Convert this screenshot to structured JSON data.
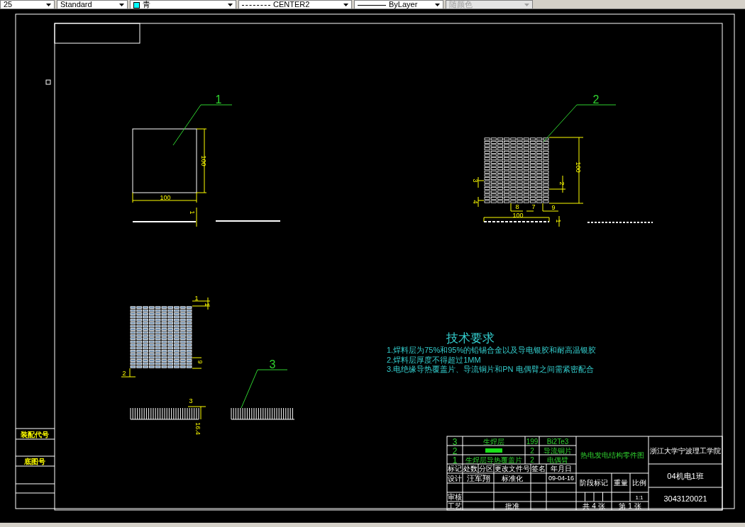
{
  "toolbar": [
    {
      "kind": "combo",
      "value": "25"
    },
    {
      "kind": "style-combo",
      "value": "Standard"
    },
    {
      "kind": "color-combo",
      "value": "青"
    },
    {
      "kind": "linetype-combo",
      "value": "CENTER2"
    },
    {
      "kind": "lineweight-combo",
      "value": "ByLayer"
    },
    {
      "kind": "combo",
      "value": "随颜色",
      "disabled": true
    }
  ],
  "left_panel": {
    "labels": [
      "装配代号",
      "底图号"
    ]
  },
  "balloons": [
    "1",
    "2",
    "3"
  ],
  "part1": {
    "dims": [
      "100",
      "100",
      "1"
    ]
  },
  "part2": {
    "dims": [
      "100",
      "3",
      "4",
      "2",
      "8",
      "7",
      "9",
      "100",
      "1"
    ]
  },
  "part3": {
    "dims": [
      "1",
      "1",
      "2",
      "9",
      "3",
      "16.4"
    ]
  },
  "tech_requirements": {
    "title": "技术要求",
    "lines": [
      "1.焊料层为75%和95%的铅锡合金以及导电银胶和耐高温银胶",
      "2.焊料层厚度不得超过1MM",
      "3.电绝缘导热覆盖片、导流铜片和PN 电偶臂之间需紧密配合"
    ]
  },
  "title_block": {
    "parts": [
      {
        "no": "3",
        "kind": "text",
        "name": "生焊层",
        "qty": "199",
        "material": "Bi2Te3"
      },
      {
        "no": "2",
        "kind": "bar",
        "qty": "2",
        "material": "导流铜片"
      },
      {
        "no": "1",
        "kind": "text",
        "name": "生焊层导热覆盖片",
        "qty": "2",
        "material": "电偶臂"
      }
    ],
    "revision_headers": [
      "标记",
      "处数",
      "分区",
      "更改文件号",
      "签名",
      "年月日"
    ],
    "design_label": "设计",
    "designer": "汪军翔",
    "std_label": "标准化",
    "date": "09-04-16",
    "review_label": "审核",
    "process_label": "工艺",
    "approve_label": "批准",
    "drawing_title": "热电发电结构零件图",
    "stage_headers": [
      "阶段标记",
      "重量",
      "比例"
    ],
    "scale": "1:1",
    "sheets_total": "共 4 张",
    "sheet_no": "第 1 张",
    "school": "浙江大学宁波理工学院",
    "class_name": "04机电1班",
    "student_id": "3043120021"
  }
}
